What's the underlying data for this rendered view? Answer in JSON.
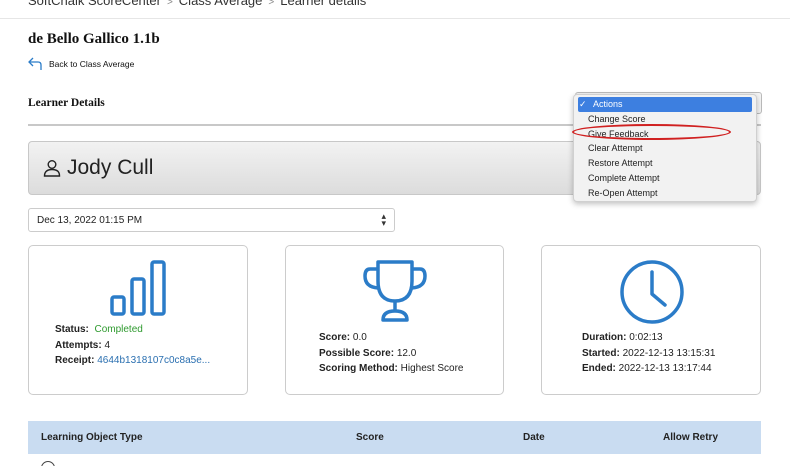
{
  "breadcrumb": {
    "items": [
      "SoftChalk ScoreCenter",
      "Class Average",
      "Learner details"
    ],
    "separator": ">"
  },
  "course_title": "de Bello Gallico 1.1b",
  "back_link": {
    "label": "Back to Class Average",
    "icon": "back-arrow-icon"
  },
  "section_title": "Learner Details",
  "actions_menu": {
    "selected": "Actions",
    "check": "✓",
    "options": [
      "Actions",
      "Change Score",
      "Give Feedback",
      "Clear Attempt",
      "Restore Attempt",
      "Complete Attempt",
      "Re-Open Attempt"
    ],
    "highlighted_option": "Give Feedback",
    "highlight_color": "#d02020",
    "selected_color": "#3d7fe0"
  },
  "learner": {
    "name": "Jody Cull",
    "icon": "person-icon"
  },
  "attempt_select": {
    "value": "Dec 13, 2022 01:15 PM"
  },
  "status_card": {
    "icon": "bar-chart-icon",
    "status_label": "Status:",
    "status_value": "Completed",
    "attempts_label": "Attempts:",
    "attempts_value": "4",
    "receipt_label": "Receipt:",
    "receipt_value": "4644b1318107c0c8a5e..."
  },
  "score_card": {
    "icon": "trophy-icon",
    "score_label": "Score:",
    "score_value": "0.0",
    "possible_label": "Possible Score:",
    "possible_value": "12.0",
    "method_label": "Scoring Method:",
    "method_value": "Highest Score"
  },
  "time_card": {
    "icon": "clock-icon",
    "duration_label": "Duration:",
    "duration_value": "0:02:13",
    "started_label": "Started:",
    "started_value": "2022-12-13 13:15:31",
    "ended_label": "Ended:",
    "ended_value": "2022-12-13 13:17:44"
  },
  "table": {
    "columns": [
      "Learning Object Type",
      "Score",
      "Date",
      "Allow Retry"
    ]
  },
  "colors": {
    "icon_blue": "#2b7cc8",
    "status_green": "#2f9a2f",
    "table_header_bg": "#c9dcf1"
  }
}
